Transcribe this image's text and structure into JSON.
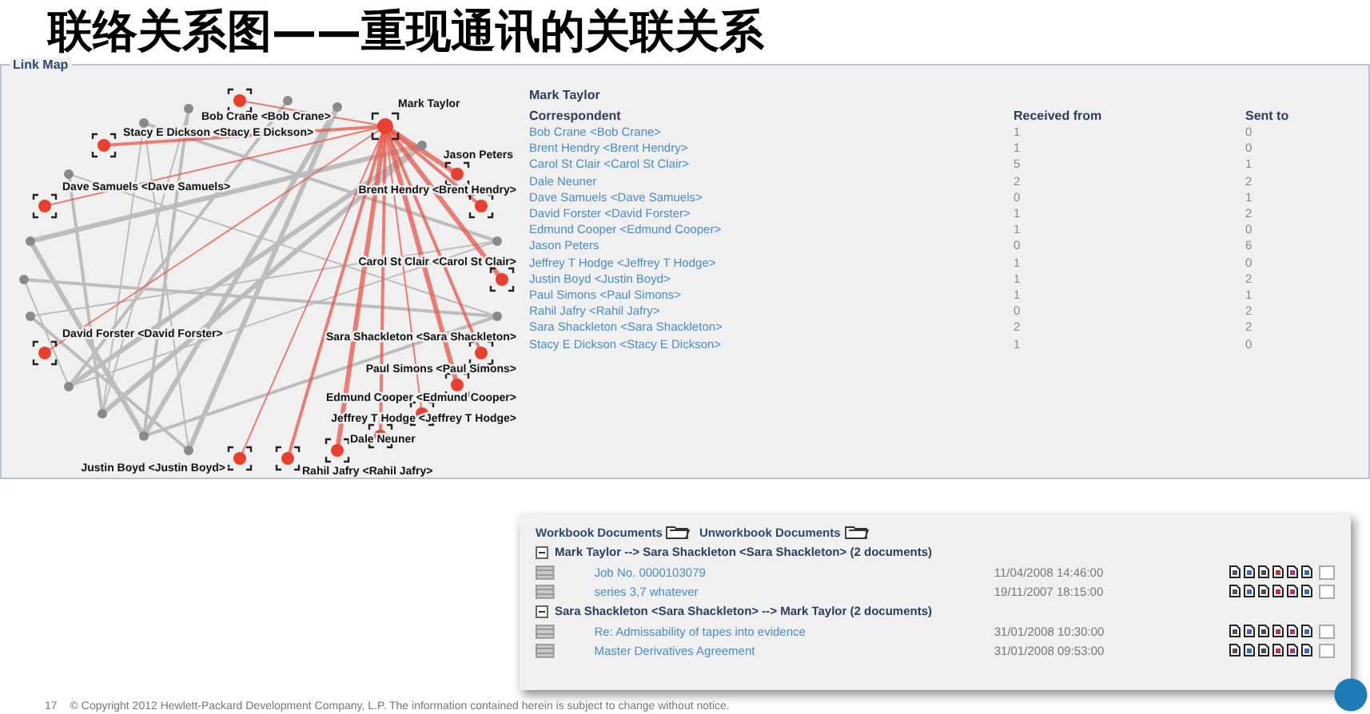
{
  "slide_title": "联络关系图——重现通讯的关联关系",
  "link_map": {
    "title": "Link Map",
    "graph": {
      "center": "Mark Taylor",
      "nodes": [
        {
          "label": "Bob Crane <Bob Crane>"
        },
        {
          "label": "Stacy E Dickson <Stacy E Dickson>"
        },
        {
          "label": "Jason Peters"
        },
        {
          "label": "Dave Samuels <Dave Samuels>"
        },
        {
          "label": "Brent Hendry <Brent Hendry>"
        },
        {
          "label": "Carol St Clair <Carol St Clair>"
        },
        {
          "label": "David Forster <David Forster>"
        },
        {
          "label": "Sara Shackleton <Sara Shackleton>"
        },
        {
          "label": "Paul Simons <Paul Simons>"
        },
        {
          "label": "Edmund Cooper <Edmund Cooper>"
        },
        {
          "label": "Jeffrey T Hodge <Jeffrey T Hodge>"
        },
        {
          "label": "Dale Neuner"
        },
        {
          "label": "Justin Boyd <Justin Boyd>"
        },
        {
          "label": "Rahil Jafry <Rahil Jafry>"
        }
      ]
    },
    "table": {
      "heading": "Mark Taylor",
      "columns": [
        "Correspondent",
        "Received from",
        "Sent to"
      ],
      "rows": [
        {
          "correspondent": "Bob Crane <Bob Crane>",
          "received_from": "1",
          "sent_to": "0"
        },
        {
          "correspondent": "Brent Hendry <Brent Hendry>",
          "received_from": "1",
          "sent_to": "0"
        },
        {
          "correspondent": "Carol St Clair <Carol St Clair>",
          "received_from": "5",
          "sent_to": "1"
        },
        {
          "correspondent": "Dale Neuner",
          "received_from": "2",
          "sent_to": "2"
        },
        {
          "correspondent": "Dave Samuels <Dave Samuels>",
          "received_from": "0",
          "sent_to": "1"
        },
        {
          "correspondent": "David Forster <David Forster>",
          "received_from": "1",
          "sent_to": "2"
        },
        {
          "correspondent": "Edmund Cooper <Edmund Cooper>",
          "received_from": "1",
          "sent_to": "0"
        },
        {
          "correspondent": "Jason Peters",
          "received_from": "0",
          "sent_to": "6"
        },
        {
          "correspondent": "Jeffrey T Hodge <Jeffrey T Hodge>",
          "received_from": "1",
          "sent_to": "0"
        },
        {
          "correspondent": "Justin Boyd <Justin Boyd>",
          "received_from": "1",
          "sent_to": "2"
        },
        {
          "correspondent": "Paul Simons <Paul Simons>",
          "received_from": "1",
          "sent_to": "1"
        },
        {
          "correspondent": "Rahil Jafry <Rahil Jafry>",
          "received_from": "0",
          "sent_to": "2"
        },
        {
          "correspondent": "Sara Shackleton <Sara Shackleton>",
          "received_from": "2",
          "sent_to": "2"
        },
        {
          "correspondent": "Stacy E Dickson <Stacy E Dickson>",
          "received_from": "1",
          "sent_to": "0"
        }
      ]
    }
  },
  "documents": {
    "tabs": [
      {
        "label": "Workbook Documents"
      },
      {
        "label": "Unworkbook Documents"
      }
    ],
    "groups": [
      {
        "title": "Mark Taylor --> Sara Shackleton <Sara Shackleton> (2 documents)",
        "expanded": true,
        "rows": [
          {
            "title": "Job No. 0000103079",
            "date": "11/04/2008 14:46:00",
            "checked": false
          },
          {
            "title": "series 3,7 whatever",
            "date": "19/11/2007 18:15:00",
            "checked": false
          }
        ]
      },
      {
        "title": "Sara Shackleton <Sara Shackleton> --> Mark Taylor (2 documents)",
        "expanded": true,
        "rows": [
          {
            "title": "Re: Admissability of tapes into evidence",
            "date": "31/01/2008 10:30:00",
            "checked": false
          },
          {
            "title": "Master Derivatives Agreement",
            "date": "31/01/2008 09:53:00",
            "checked": false
          }
        ]
      }
    ]
  },
  "footer": {
    "page": "17",
    "copyright": "© Copyright 2012 Hewlett-Packard Development Company, L.P. The information contained herein is subject to change without notice."
  }
}
